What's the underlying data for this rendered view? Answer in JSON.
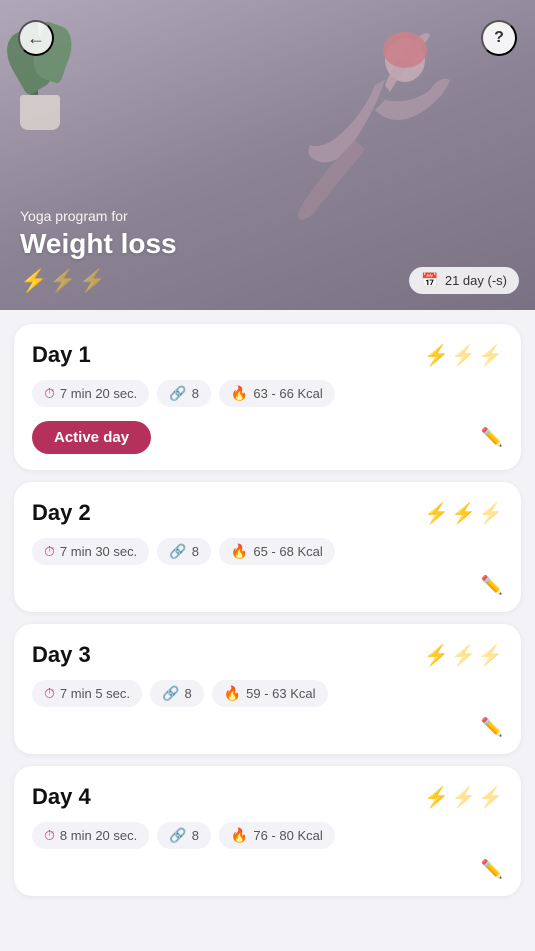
{
  "hero": {
    "back_label": "←",
    "help_label": "?",
    "subtitle": "Yoga program for",
    "title": "Weight loss",
    "days_badge": "21 day (-s)",
    "lightnings": [
      {
        "active": true
      },
      {
        "active": false
      },
      {
        "active": false
      }
    ]
  },
  "days": [
    {
      "label": "Day 1",
      "lightnings": [
        true,
        false,
        false
      ],
      "stats": {
        "time": "7 min 20 sec.",
        "exercises": "8",
        "kcal": "63 - 66 Kcal"
      },
      "is_active": true,
      "active_label": "Active day"
    },
    {
      "label": "Day 2",
      "lightnings": [
        true,
        true,
        false
      ],
      "stats": {
        "time": "7 min 30 sec.",
        "exercises": "8",
        "kcal": "65 - 68 Kcal"
      },
      "is_active": false,
      "active_label": ""
    },
    {
      "label": "Day 3",
      "lightnings": [
        true,
        false,
        false
      ],
      "stats": {
        "time": "7 min 5 sec.",
        "exercises": "8",
        "kcal": "59 - 63 Kcal"
      },
      "is_active": false,
      "active_label": ""
    },
    {
      "label": "Day 4",
      "lightnings": [
        true,
        false,
        false
      ],
      "stats": {
        "time": "8 min 20 sec.",
        "exercises": "8",
        "kcal": "76 - 80 Kcal"
      },
      "is_active": false,
      "active_label": ""
    }
  ]
}
